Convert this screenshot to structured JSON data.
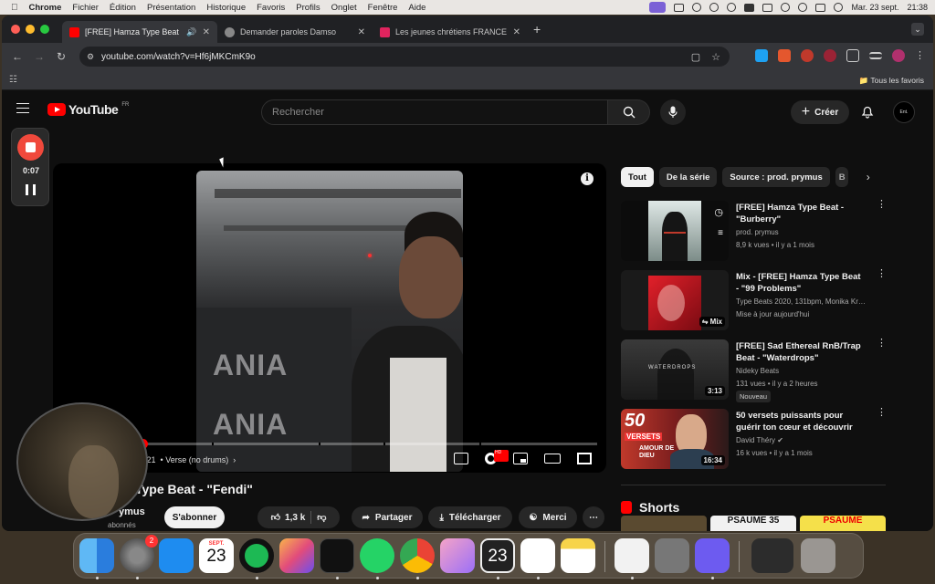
{
  "menubar": {
    "app": "Chrome",
    "items": [
      "Fichier",
      "Édition",
      "Présentation",
      "Historique",
      "Favoris",
      "Profils",
      "Onglet",
      "Fenêtre",
      "Aide"
    ],
    "datetime": "Mar. 23 sept.",
    "time": "21:38"
  },
  "tabs": [
    {
      "title": "[FREE] Hamza Type Beat",
      "active": true,
      "color": "#ff0000"
    },
    {
      "title": "Demander paroles Damso",
      "active": false,
      "color": "#888888"
    },
    {
      "title": "Les jeunes chrétiens FRANCE",
      "active": false,
      "color": "#e0245e"
    }
  ],
  "toolbar": {
    "url": "youtube.com/watch?v=Hf6jMKCmK9o",
    "bookmarks_label": "Tous les favoris"
  },
  "youtube": {
    "logo": "YouTube",
    "region": "FR",
    "search_placeholder": "Rechercher",
    "create_label": "Créer",
    "avatar_text": "Ent."
  },
  "recorder": {
    "time": "0:07"
  },
  "player": {
    "time_text": "/ 2:21",
    "chapter": "• Verse (no drums)",
    "progress": 0.15,
    "wall_text": [
      "ANIA",
      "ANIA"
    ],
    "hd_badge": "HD"
  },
  "video": {
    "title": "Type Beat - \"Fendi\"",
    "channel": "ymus",
    "subscribers": "abonnés",
    "subscribe": "S'abonner",
    "likes": "1,3 k",
    "share": "Partager",
    "download": "Télécharger",
    "thanks": "Merci"
  },
  "chips": [
    "Tout",
    "De la série",
    "Source : prod. prymus",
    "B"
  ],
  "recommendations": [
    {
      "title": "[FREE] Hamza Type Beat - \"Burberry\"",
      "meta1": "prod. prymus",
      "meta2": "8,9 k vues • il y a 1 mois",
      "duration": "",
      "badge": ""
    },
    {
      "title": "Mix - [FREE] Hamza Type Beat - \"99 Problems\"",
      "meta1": "Type Beats 2020, 131bpm, Monika Kruse...",
      "meta2": "Mise à jour aujourd'hui",
      "duration": "Mix",
      "badge": ""
    },
    {
      "title": "[FREE] Sad Ethereal RnB/Trap Beat - \"Waterdrops\"",
      "meta1": "Nideky Beats",
      "meta2": "131 vues • il y a 2 heures",
      "duration": "3:13",
      "badge": "Nouveau",
      "thumb_text": "WATERDROPS"
    },
    {
      "title": "50 versets puissants pour guérir ton cœur et découvrir l'amour ...",
      "meta1": "David Théry",
      "meta2": "16 k vues • il y a 1 mois",
      "duration": "16:34",
      "badge": "",
      "thumb_text": "50",
      "thumb_text2": "VERSETS",
      "thumb_text3": "AMOUR DE DIEU"
    }
  ],
  "shorts": {
    "label": "Shorts",
    "thumb1": "",
    "thumb2": "PSAUME 35",
    "thumb3": "PSAUME"
  },
  "dock": {
    "calendar_month": "SEPT.",
    "calendar_day": "23",
    "settings_badge": "2",
    "extra_day": "23"
  }
}
